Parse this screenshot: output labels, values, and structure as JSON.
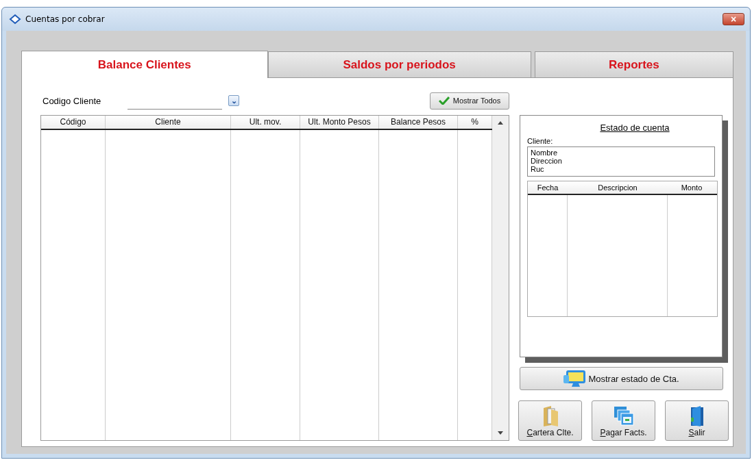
{
  "window": {
    "title": "Cuentas por cobrar",
    "close_label": "×"
  },
  "tabs": [
    {
      "label": "Balance Clientes",
      "selected": true
    },
    {
      "label": "Saldos por periodos",
      "selected": false
    },
    {
      "label": "Reportes",
      "selected": false
    }
  ],
  "filter": {
    "label": "Codigo Cliente",
    "dropdown_arrow": "⌄",
    "show_all_button": "Mostrar Todos"
  },
  "table": {
    "columns": [
      "Código",
      "Cliente",
      "Ult. mov.",
      "Ult. Monto Pesos",
      "Balance Pesos",
      "%"
    ]
  },
  "statement": {
    "title": "Estado de cuenta",
    "client_label": "Cliente:",
    "client_lines": [
      "Nombre",
      "Direccion",
      "Ruc"
    ],
    "columns": [
      "Fecha",
      "Descripcion",
      "Monto"
    ]
  },
  "show_statement_button": "Mostrar estado de Cta.",
  "action_buttons": [
    {
      "kind": "folder",
      "label": "Cartera Clte.",
      "mnemonic": true
    },
    {
      "kind": "sheets",
      "label": "Pagar Facts.",
      "mnemonic": true
    },
    {
      "kind": "door",
      "label": "Salir",
      "mnemonic": true
    }
  ]
}
